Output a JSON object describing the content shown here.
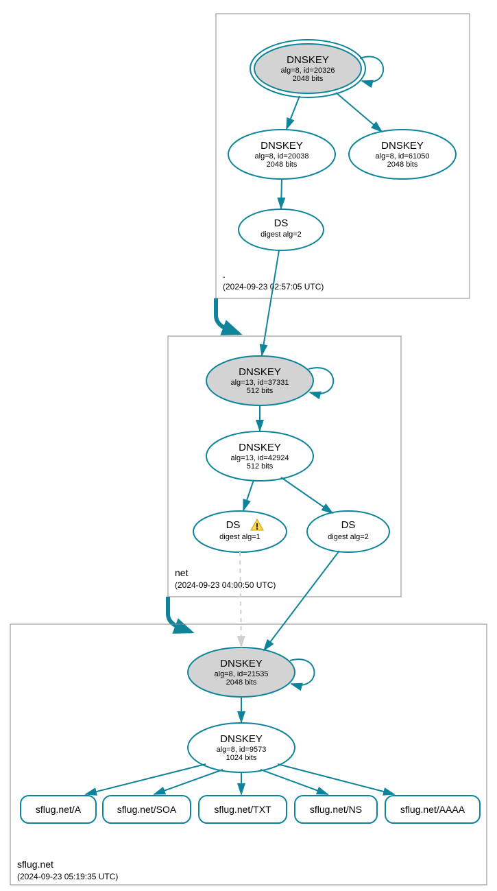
{
  "colors": {
    "accent": "#0e849b",
    "ksk_fill": "#d3d3d3"
  },
  "zones": {
    "root": {
      "label": ".",
      "timestamp": "(2024-09-23 02:57:05 UTC)",
      "ksk": {
        "title": "DNSKEY",
        "line2": "alg=8, id=20326",
        "line3": "2048 bits"
      },
      "zsk": {
        "title": "DNSKEY",
        "line2": "alg=8, id=20038",
        "line3": "2048 bits"
      },
      "extra": {
        "title": "DNSKEY",
        "line2": "alg=8, id=61050",
        "line3": "2048 bits"
      },
      "ds": {
        "title": "DS",
        "line2": "digest alg=2"
      }
    },
    "net": {
      "label": "net",
      "timestamp": "(2024-09-23 04:00:50 UTC)",
      "ksk": {
        "title": "DNSKEY",
        "line2": "alg=13, id=37331",
        "line3": "512 bits"
      },
      "zsk": {
        "title": "DNSKEY",
        "line2": "alg=13, id=42924",
        "line3": "512 bits"
      },
      "ds1": {
        "title": "DS",
        "line2": "digest alg=1",
        "warning": true
      },
      "ds2": {
        "title": "DS",
        "line2": "digest alg=2"
      }
    },
    "domain": {
      "label": "sflug.net",
      "timestamp": "(2024-09-23 05:19:35 UTC)",
      "ksk": {
        "title": "DNSKEY",
        "line2": "alg=8, id=21535",
        "line3": "2048 bits"
      },
      "zsk": {
        "title": "DNSKEY",
        "line2": "alg=8, id=9573",
        "line3": "1024 bits"
      },
      "rrsets": [
        {
          "label": "sflug.net/A"
        },
        {
          "label": "sflug.net/SOA"
        },
        {
          "label": "sflug.net/TXT"
        },
        {
          "label": "sflug.net/NS"
        },
        {
          "label": "sflug.net/AAAA"
        }
      ]
    }
  }
}
